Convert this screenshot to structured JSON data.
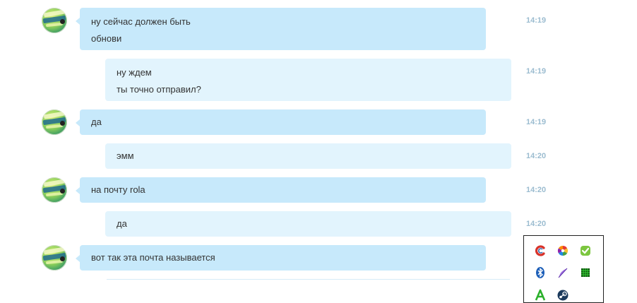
{
  "messages": [
    {
      "direction": "in",
      "lines": [
        "ну сейчас должен быть",
        "обнови"
      ],
      "time": "14:19"
    },
    {
      "direction": "out",
      "lines": [
        "ну ждем",
        "ты точно отправил?"
      ],
      "time": "14:19"
    },
    {
      "direction": "in",
      "lines": [
        "да"
      ],
      "time": "14:19"
    },
    {
      "direction": "out",
      "lines": [
        "эмм"
      ],
      "time": "14:20"
    },
    {
      "direction": "in",
      "lines": [
        "на почту rola"
      ],
      "time": "14:20"
    },
    {
      "direction": "out",
      "lines": [
        "да"
      ],
      "time": "14:20"
    },
    {
      "direction": "in",
      "lines": [
        "вот так эта почта называется"
      ],
      "time": ""
    }
  ],
  "tray": {
    "icons": [
      "ccleaner-icon",
      "picasa-icon",
      "green-check-icon",
      "bluetooth-icon",
      "feather-icon",
      "green-grid-icon",
      "green-a-icon",
      "steam-icon"
    ]
  },
  "colors": {
    "bubble_in": "#c7e9fb",
    "bubble_out": "#e2f4fd",
    "timestamp": "#9bbcd0"
  }
}
